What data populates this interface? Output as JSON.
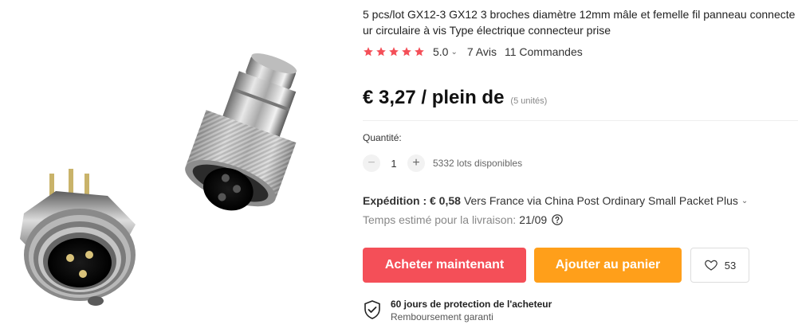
{
  "product": {
    "title": "5 pcs/lot GX12-3 GX12 3 broches diamètre 12mm mâle et femelle fil panneau connecteur circulaire à vis Type électrique connecteur prise",
    "image_icon": "connector-product-photo"
  },
  "rating": {
    "stars": 5,
    "value": "5.0",
    "reviews": "7 Avis",
    "orders": "11 Commandes",
    "star_color": "#f44f58"
  },
  "price": {
    "text": "€ 3,27 / plein de",
    "unit_note": "(5 unités)"
  },
  "quantity": {
    "label": "Quantité:",
    "minus": "−",
    "value": "1",
    "plus": "+",
    "available": "5332 lots disponibles"
  },
  "shipping": {
    "label": "Expédition : € 0,58",
    "detail": "Vers France via China Post Ordinary Small Packet Plus",
    "chevron": "⌄"
  },
  "delivery": {
    "label": "Temps estimé pour la livraison:",
    "date": "21/09"
  },
  "actions": {
    "buy_now": "Acheter maintenant",
    "add_to_cart": "Ajouter au panier",
    "wishlist_count": "53",
    "buy_color": "#f44f58",
    "cart_color": "#ff9f1a"
  },
  "protection": {
    "title": "60 jours de protection de l'acheteur",
    "subtitle": "Remboursement garanti"
  }
}
